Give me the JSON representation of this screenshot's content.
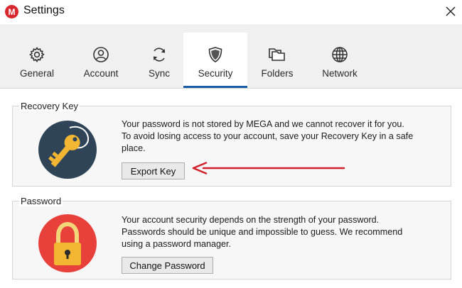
{
  "window": {
    "title": "Settings",
    "logo_letter": "M",
    "logo_icon": "mega-logo-icon",
    "close_icon": "close-icon"
  },
  "tabs": [
    {
      "label": "General",
      "icon": "gear-icon",
      "active": false
    },
    {
      "label": "Account",
      "icon": "user-icon",
      "active": false
    },
    {
      "label": "Sync",
      "icon": "sync-icon",
      "active": false
    },
    {
      "label": "Security",
      "icon": "shield-icon",
      "active": true
    },
    {
      "label": "Folders",
      "icon": "folders-icon",
      "active": false
    },
    {
      "label": "Network",
      "icon": "globe-icon",
      "active": false
    }
  ],
  "recovery": {
    "label": "Recovery Key",
    "icon": "key-icon",
    "line1": "Your password is not stored by MEGA and we cannot recover it for you.",
    "line2": "To avoid losing access to your account, save your Recovery Key in a safe",
    "line3": "place.",
    "button": "Export Key",
    "arrow_icon": "red-arrow-annotation"
  },
  "password": {
    "label": "Password",
    "icon": "padlock-icon",
    "line1": "Your account security depends on the strength of your password.",
    "line2": "Passwords should be unique and impossible to guess. We recommend",
    "line3": "using a password manager.",
    "button": "Change Password"
  },
  "colors": {
    "accent": "#1a5da8",
    "mega_red": "#d9272e",
    "annotation_red": "#d0202a",
    "key_circle": "#2f4557",
    "lock_circle": "#e8413c",
    "gold": "#f2b632"
  }
}
